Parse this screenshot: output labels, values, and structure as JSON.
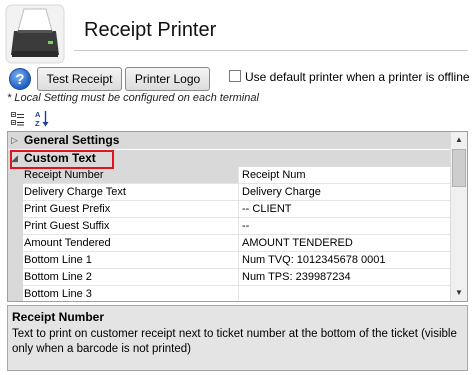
{
  "header": {
    "title": "Receipt Printer"
  },
  "toolbar": {
    "test_receipt_label": "Test Receipt",
    "printer_logo_label": "Printer Logo",
    "default_printer_label": "Use default printer when a printer is offline",
    "default_printer_checked": false,
    "local_note": "* Local Setting must be configured on each terminal"
  },
  "grid": {
    "categories": [
      {
        "label": "General Settings",
        "expanded": false
      },
      {
        "label": "Custom Text",
        "expanded": true
      }
    ],
    "rows": [
      {
        "name": "Receipt Number",
        "value": "Receipt Num",
        "selected": true
      },
      {
        "name": "Delivery Charge Text",
        "value": "Delivery Charge"
      },
      {
        "name": "Print Guest Prefix",
        "value": "-- CLIENT"
      },
      {
        "name": "Print Guest Suffix",
        "value": "--"
      },
      {
        "name": "Amount Tendered",
        "value": "AMOUNT TENDERED"
      },
      {
        "name": "Bottom Line 1",
        "value": "Num TVQ: 1012345678 0001"
      },
      {
        "name": "Bottom Line 2",
        "value": "Num TPS: 239987234"
      },
      {
        "name": "Bottom Line 3",
        "value": ""
      }
    ]
  },
  "description": {
    "title": "Receipt Number",
    "text": "Text to print on customer receipt next to ticket number at the bottom of the ticket (visible only when a barcode is not printed)"
  },
  "icons": {
    "printer": "receipt-printer-icon",
    "help": "help-icon",
    "categorized": "categorized-sort-icon",
    "alphabetical": "alphabetical-sort-icon"
  },
  "colors": {
    "highlight": "#e0141e",
    "category_bg": "#d9d9d9",
    "help_blue": "#1f5fc4"
  }
}
